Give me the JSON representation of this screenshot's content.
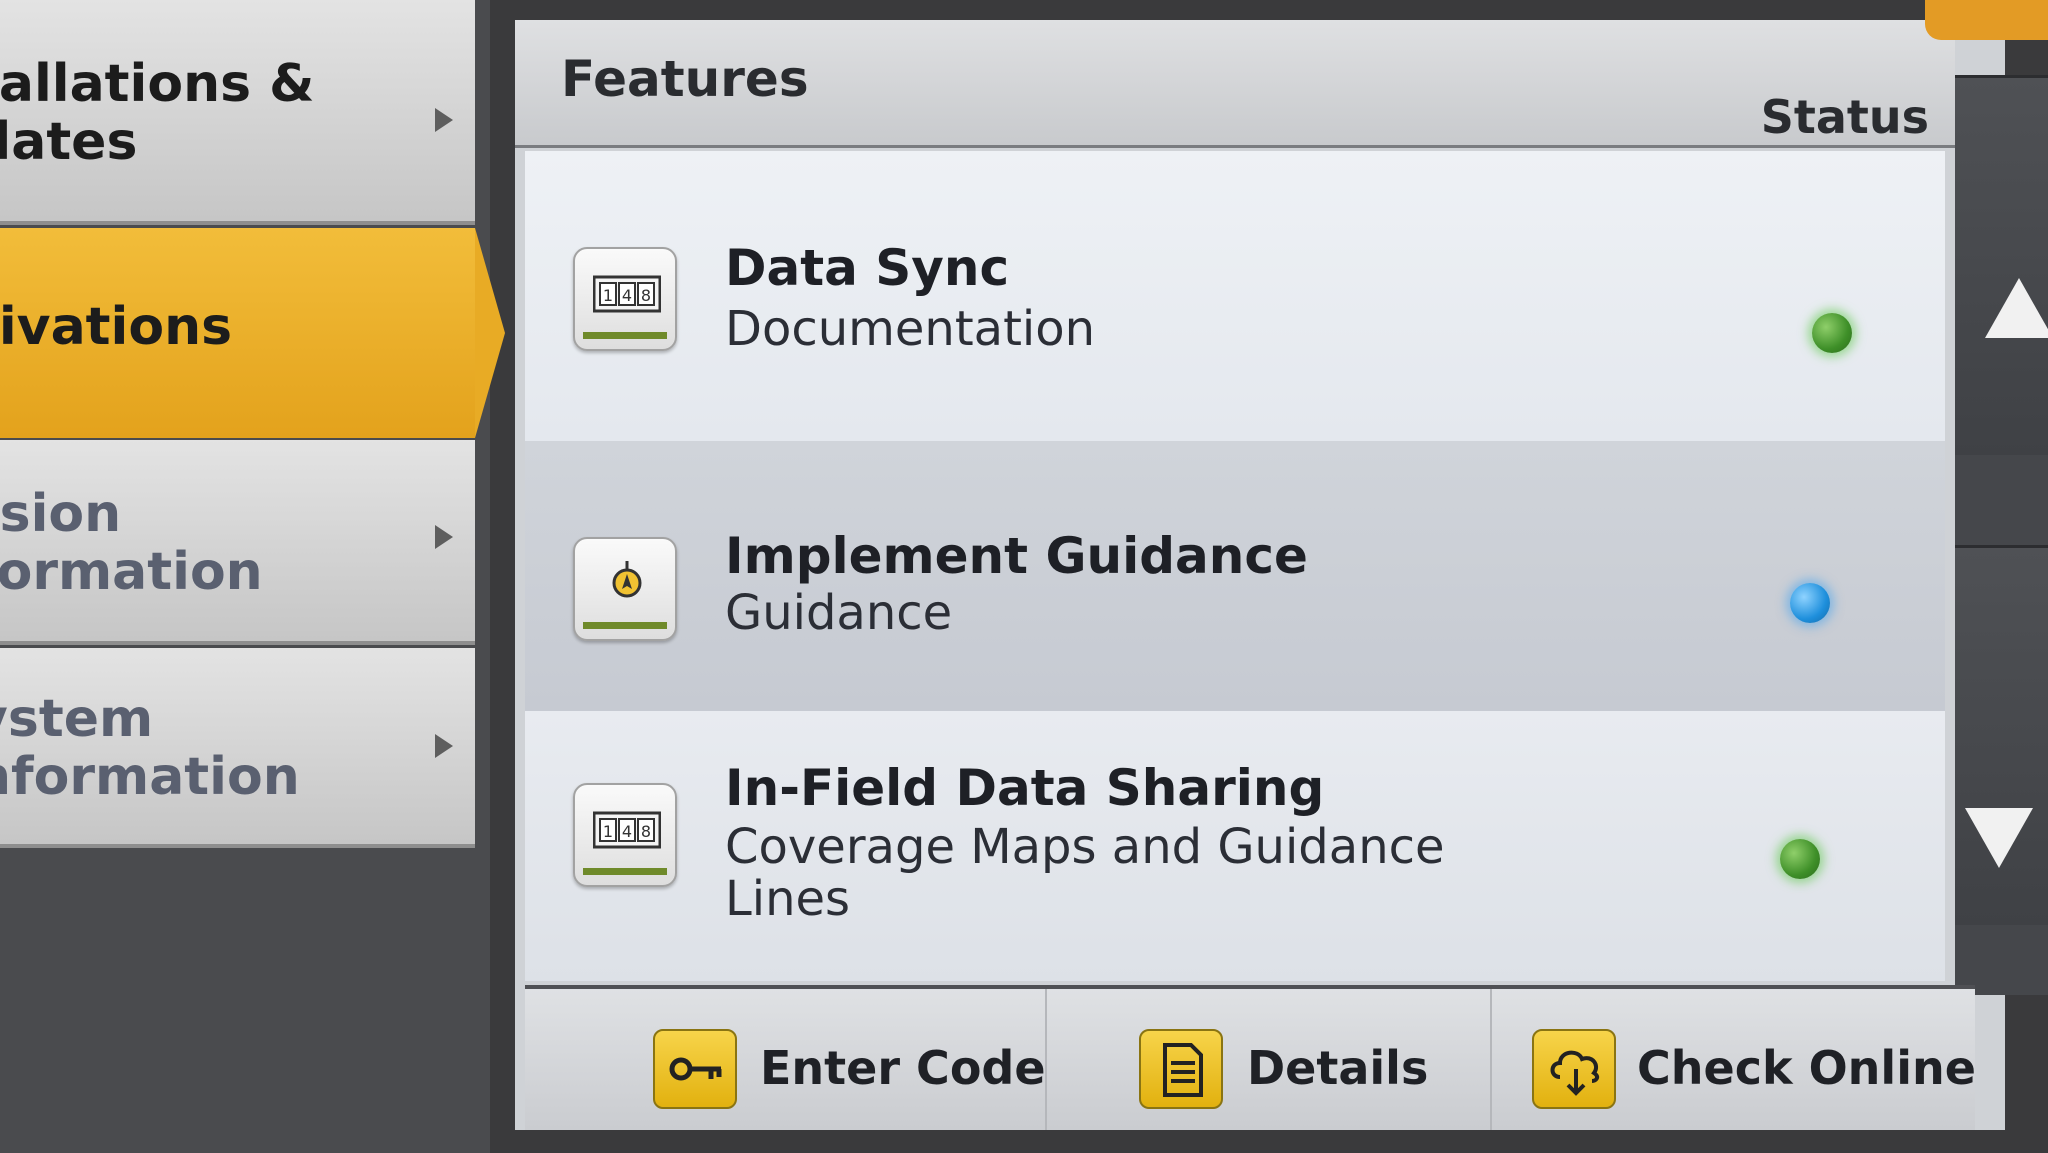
{
  "sidebar": {
    "items": [
      {
        "label": "tallations &\ndates",
        "state": "default"
      },
      {
        "label": "tivations",
        "state": "selected"
      },
      {
        "label": "rsion\nformation",
        "state": "default"
      },
      {
        "label": "ystem\nnformation",
        "state": "default"
      }
    ]
  },
  "panel": {
    "features_header": "Features",
    "status_header": "Status"
  },
  "features": [
    {
      "title": "Data Sync",
      "subtitle": "Documentation",
      "icon": "counter-icon",
      "status": "green"
    },
    {
      "title": "Implement Guidance",
      "subtitle": "Guidance",
      "icon": "guidance-icon",
      "status": "blue"
    },
    {
      "title": "In-Field Data Sharing",
      "subtitle": "Coverage Maps and Guidance Lines",
      "icon": "counter-icon",
      "status": "green"
    }
  ],
  "toolbar": {
    "enter_code": "Enter Code",
    "details": "Details",
    "check_online": "Check Online"
  },
  "colors": {
    "accent": "#e8ab25",
    "status_green": "#3e8f28",
    "status_blue": "#1e8fdc"
  }
}
